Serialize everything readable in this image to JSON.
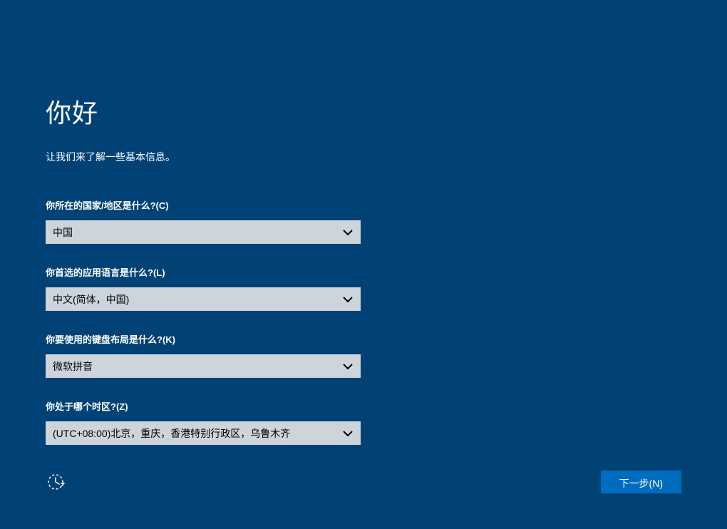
{
  "header": {
    "title": "你好",
    "subtitle": "让我们来了解一些基本信息。"
  },
  "fields": {
    "country": {
      "label": "你所在的国家/地区是什么?(C)",
      "value": "中国"
    },
    "language": {
      "label": "你首选的应用语言是什么?(L)",
      "value": "中文(简体，中国)"
    },
    "keyboard": {
      "label": "你要使用的键盘布局是什么?(K)",
      "value": "微软拼音"
    },
    "timezone": {
      "label": "你处于哪个时区?(Z)",
      "value": "(UTC+08:00)北京，重庆，香港特别行政区，乌鲁木齐"
    }
  },
  "footer": {
    "next_label": "下一步(N)"
  }
}
